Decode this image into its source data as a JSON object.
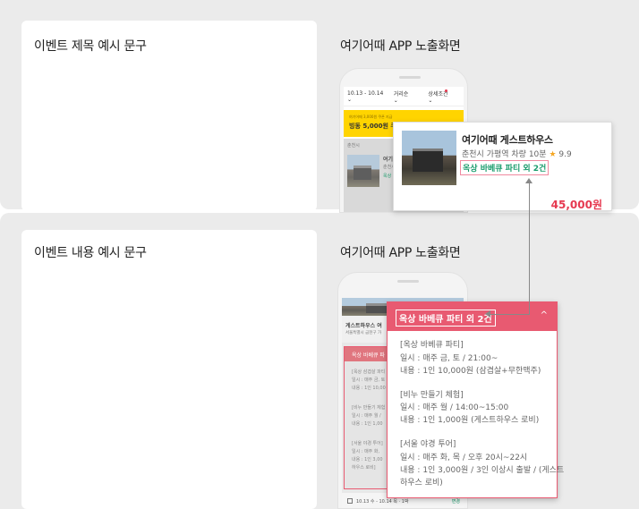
{
  "sections": {
    "top": {
      "event_title_label": "이벤트 제목 예시 문구",
      "app_label": "여기어때 APP 노출화면"
    },
    "bottom": {
      "event_content_label": "이벤트 내용 예시 문구",
      "app_label": "여기어때 APP 노출화면"
    }
  },
  "phone1": {
    "filters": [
      "10.13 - 10.14 ⌄",
      "거리순 ⌄",
      "상세조건 ⌄"
    ],
    "banner_small": "여기어때 3,000원 쿠폰 지급",
    "banner_big": "빙동 5,000원 쿠폰",
    "list_place": "춘천시",
    "list_name": "여기어",
    "list_loc": "춘천시",
    "list_tag": "옥상"
  },
  "popup_card": {
    "name": "여기어때 게스트하우스",
    "location": "춘천시 가평역 차량 10분",
    "star": "★",
    "rating": "9.9",
    "tag": "옥상 바베큐 파티 외 2건",
    "price": "45,000원"
  },
  "phone2": {
    "hotel_name": "게스트하우스 여",
    "hotel_addr": "서울특별시 금천구 가",
    "section_head": "옥상 바베큐 파",
    "mini_lines": [
      "[옥상 삼겹살 파티",
      "일시 : 매주 금, 토",
      "내용 : 1인 10,00",
      "[비누 만들기 체험",
      "일시 : 매주 월 /",
      "내용 : 1인 1,00",
      "[서울 야경 투어]",
      "일시 : 매주 화,",
      "내용 : 1인 3,00",
      "하우스 로비]"
    ],
    "date_bar": "10.13 수 - 10.14 목 · 1박",
    "date_right": "변경"
  },
  "popup_detail": {
    "title": "옥상 바베큐 파티 외 2건",
    "chevron": "^",
    "lines": [
      "[옥상 바베큐 파티]",
      "일시 : 매주 금, 토 / 21:00~",
      "내용 : 1인 10,000원 (삼겹살+무한맥주)",
      "",
      "[비누 만들기 체험]",
      "일시 : 매주 월 / 14:00~15:00",
      "내용 : 1인 1,000원 (게스트하우스 로비)",
      "",
      "[서울 야경 투어]",
      "일시 : 매주 화, 목 / 오후 20시~22시",
      "내용 : 1인 3,000원 / 3인 이상시 출발 / (게스트",
      "하우스 로비)"
    ]
  },
  "colors": {
    "accent_pink": "#e85a71",
    "price_red": "#e63950",
    "tag_green": "#1a9c6c",
    "banner_yellow": "#ffd400"
  }
}
